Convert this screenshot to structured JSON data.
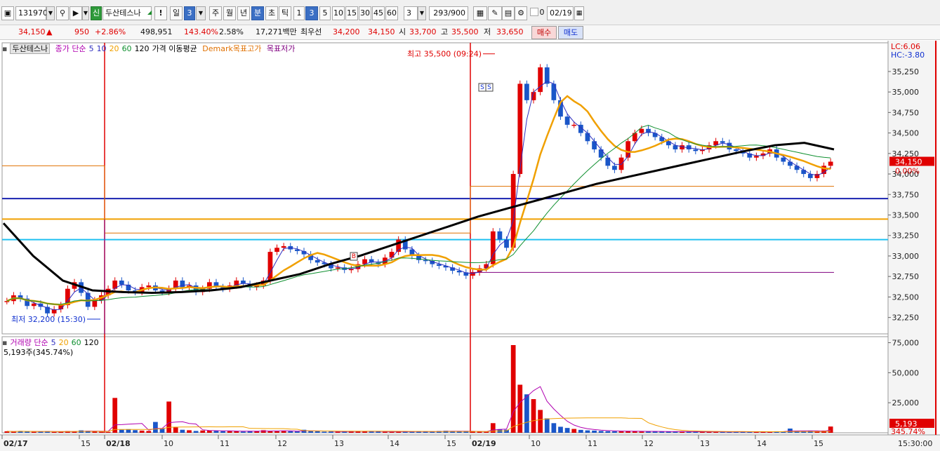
{
  "toolbar": {
    "code": "131970",
    "badge": "신",
    "stock_name": "두산테스나",
    "period_buttons": [
      "일",
      "3",
      "주",
      "월",
      "년",
      "분",
      "초",
      "틱"
    ],
    "interval_buttons": [
      "1",
      "3",
      "5",
      "10",
      "15",
      "30",
      "45",
      "60"
    ],
    "interval_value": "3",
    "count": "293",
    "count_max": "/900",
    "checkbox_label": "0",
    "date": "02/19"
  },
  "quote": {
    "price": "34,150",
    "arrow": "▲",
    "change": "950",
    "change_pct": "+2.86%",
    "volume": "498,951",
    "volume_ratio": "143.40%",
    "turnover_rate": "2.58%",
    "amount": "17,271백만",
    "ask_label": "최우선",
    "ask_price": "34,200",
    "bid_price": "34,150",
    "open_label": "시",
    "open": "33,700",
    "high_label": "고",
    "high": "35,500",
    "low_label": "저",
    "low": "33,650",
    "buy_label": "매수",
    "sell_label": "매도"
  },
  "price_legend": {
    "stock": "두산테스나",
    "series_label": "종가 단순",
    "ma_periods": [
      "5",
      "10",
      "20",
      "60",
      "120"
    ],
    "ma_label": "가격 이동평균",
    "demark_high": "Demark목표고가",
    "demark_low": "목표저가"
  },
  "volume_legend": {
    "label": "거래량 단순",
    "ma_periods": [
      "5",
      "20",
      "60",
      "120"
    ],
    "value": "5,193주(345.74%)"
  },
  "annotations": {
    "high": "최고 35,500 (09:24)",
    "low": "최저 32,200 (15:30)",
    "marker_s": "S",
    "marker_b": "B"
  },
  "right_panel": {
    "lc": "LC:6.06",
    "hc": "HC:-3.80",
    "price_tag": "34,150",
    "pct_tag": "0.00%",
    "vol_tag": "5,193",
    "vol_pct_tag": "345.74%",
    "time": "15:30:00"
  },
  "colors": {
    "up": "#e00000",
    "down": "#1a56c8",
    "ma5": "#3030c0",
    "ma20": "#f0a000",
    "ma60": "#109030",
    "ma120": "#000000"
  },
  "chart_data": [
    {
      "type": "candlestick",
      "title": "두산테스나",
      "x_ticks": [
        "02/17",
        "15",
        "02/18",
        "10",
        "11",
        "12",
        "13",
        "14",
        "15",
        "02/19",
        "10",
        "11",
        "12",
        "13",
        "14",
        "15"
      ],
      "y_ticks": [
        35250,
        35000,
        34750,
        34500,
        34250,
        34000,
        33750,
        33500,
        33250,
        33000,
        32750,
        32500,
        32250
      ],
      "ylim": [
        32050,
        35600
      ],
      "current_price": 34150,
      "high": 35500,
      "low": 32200,
      "horizontal_lines": [
        {
          "value": 33700,
          "color": "#1a23b0"
        },
        {
          "value": 33450,
          "color": "#f0a000"
        },
        {
          "value": 33200,
          "color": "#20c0f0"
        }
      ],
      "close_series": [
        32450,
        32520,
        32480,
        32390,
        32420,
        32380,
        32300,
        32350,
        32400,
        32600,
        32680,
        32550,
        32380,
        32460,
        32520,
        32600,
        32700,
        32650,
        32580,
        32560,
        32620,
        32640,
        32580,
        32560,
        32600,
        32700,
        32620,
        32640,
        32560,
        32600,
        32680,
        32620,
        32600,
        32640,
        32700,
        32660,
        32620,
        32640,
        32700,
        33050,
        33100,
        33120,
        33080,
        33060,
        33020,
        32950,
        32920,
        32900,
        32850,
        32860,
        32830,
        32840,
        32900,
        32960,
        32920,
        32900,
        32980,
        33050,
        33200,
        33080,
        33000,
        32950,
        32940,
        32900,
        32880,
        32860,
        32820,
        32800,
        32760,
        32800,
        32850,
        32900,
        33300,
        33200,
        33100,
        34000,
        35100,
        34900,
        35000,
        35300,
        35100,
        34900,
        34700,
        34600,
        34600,
        34500,
        34400,
        34300,
        34200,
        34100,
        34050,
        34200,
        34400,
        34500,
        34550,
        34500,
        34450,
        34400,
        34350,
        34300,
        34350,
        34300,
        34280,
        34300,
        34350,
        34400,
        34380,
        34300,
        34280,
        34250,
        34200,
        34220,
        34250,
        34300,
        34200,
        34150,
        34100,
        34050,
        34000,
        33950,
        34000,
        34100,
        34150
      ],
      "ma120_series": [
        33400,
        33000,
        32700,
        32580,
        32560,
        32550,
        32560,
        32580,
        32620,
        32700,
        32780,
        32900,
        33000,
        33120,
        33240,
        33360,
        33480,
        33580,
        33680,
        33780,
        33880,
        33960,
        34040,
        34120,
        34200,
        34280,
        34350,
        34380,
        34300
      ]
    },
    {
      "type": "bar",
      "title": "거래량",
      "y_ticks": [
        75000,
        50000,
        25000
      ],
      "ylim": [
        0,
        80000
      ],
      "volume": [
        1200,
        900,
        1500,
        1100,
        800,
        1000,
        1300,
        700,
        900,
        1400,
        1100,
        2000,
        1600,
        900,
        800,
        700,
        29000,
        2500,
        3000,
        2200,
        1800,
        1500,
        9000,
        3800,
        26000,
        4500,
        2500,
        2100,
        1500,
        1900,
        1700,
        1500,
        1300,
        1400,
        1200,
        1000,
        1500,
        1300,
        2100,
        1400,
        1200,
        1800,
        1300,
        1100,
        2500,
        1500,
        1200,
        900,
        1000,
        800,
        1100,
        1500,
        1300,
        1200,
        900,
        1000,
        800,
        700,
        1200,
        1100,
        900,
        1000,
        1100,
        900,
        1500,
        1700,
        1300,
        1200,
        900,
        1100,
        1000,
        800,
        8000,
        3000,
        2500,
        73000,
        40000,
        32000,
        28000,
        19000,
        12000,
        8000,
        5000,
        4000,
        3200,
        2400,
        2000,
        1800,
        1500,
        1300,
        1200,
        1100,
        1500,
        1300,
        1000,
        900,
        1200,
        1100,
        1000,
        900,
        800,
        900,
        1000,
        800,
        700,
        900,
        800,
        700,
        1000,
        800,
        700,
        900,
        800,
        700,
        1200,
        1000,
        3500,
        1200,
        900,
        1600,
        1100,
        1800,
        5193
      ]
    }
  ]
}
